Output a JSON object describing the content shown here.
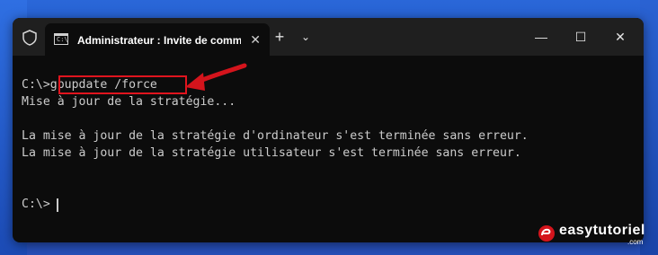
{
  "window": {
    "tab_title": "Administrateur : Invite de commandes",
    "tab_icon_text": "C:\\",
    "new_tab": "+",
    "dropdown": "⌄",
    "minimize": "—",
    "maximize": "☐",
    "close": "✕",
    "tab_close": "✕"
  },
  "terminal": {
    "prompt1": "C:\\>",
    "command": "gpupdate /force",
    "line2": "Mise à jour de la stratégie...",
    "line4": "La mise à jour de la stratégie d'ordinateur s'est terminée sans erreur.",
    "line5": "La mise à jour de la stratégie utilisateur s'est terminée sans erreur.",
    "prompt2": "C:\\>"
  },
  "watermark": {
    "brand": "easytutoriel",
    "tld": ".com"
  },
  "colors": {
    "highlight": "#e0141e",
    "terminal_bg": "#0c0c0c",
    "terminal_text": "#cccccc"
  }
}
